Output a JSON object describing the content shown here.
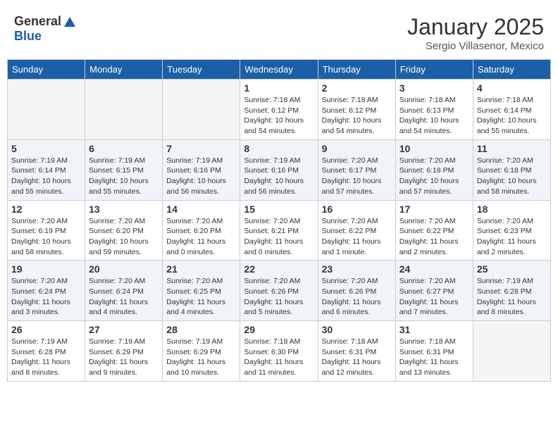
{
  "header": {
    "logo_line1": "General",
    "logo_line2": "Blue",
    "month_title": "January 2025",
    "subtitle": "Sergio Villasenor, Mexico"
  },
  "weekdays": [
    "Sunday",
    "Monday",
    "Tuesday",
    "Wednesday",
    "Thursday",
    "Friday",
    "Saturday"
  ],
  "weeks": [
    [
      {
        "day": "",
        "info": ""
      },
      {
        "day": "",
        "info": ""
      },
      {
        "day": "",
        "info": ""
      },
      {
        "day": "1",
        "info": "Sunrise: 7:18 AM\nSunset: 6:12 PM\nDaylight: 10 hours\nand 54 minutes."
      },
      {
        "day": "2",
        "info": "Sunrise: 7:18 AM\nSunset: 6:12 PM\nDaylight: 10 hours\nand 54 minutes."
      },
      {
        "day": "3",
        "info": "Sunrise: 7:18 AM\nSunset: 6:13 PM\nDaylight: 10 hours\nand 54 minutes."
      },
      {
        "day": "4",
        "info": "Sunrise: 7:18 AM\nSunset: 6:14 PM\nDaylight: 10 hours\nand 55 minutes."
      }
    ],
    [
      {
        "day": "5",
        "info": "Sunrise: 7:19 AM\nSunset: 6:14 PM\nDaylight: 10 hours\nand 55 minutes."
      },
      {
        "day": "6",
        "info": "Sunrise: 7:19 AM\nSunset: 6:15 PM\nDaylight: 10 hours\nand 55 minutes."
      },
      {
        "day": "7",
        "info": "Sunrise: 7:19 AM\nSunset: 6:16 PM\nDaylight: 10 hours\nand 56 minutes."
      },
      {
        "day": "8",
        "info": "Sunrise: 7:19 AM\nSunset: 6:16 PM\nDaylight: 10 hours\nand 56 minutes."
      },
      {
        "day": "9",
        "info": "Sunrise: 7:20 AM\nSunset: 6:17 PM\nDaylight: 10 hours\nand 57 minutes."
      },
      {
        "day": "10",
        "info": "Sunrise: 7:20 AM\nSunset: 6:18 PM\nDaylight: 10 hours\nand 57 minutes."
      },
      {
        "day": "11",
        "info": "Sunrise: 7:20 AM\nSunset: 6:18 PM\nDaylight: 10 hours\nand 58 minutes."
      }
    ],
    [
      {
        "day": "12",
        "info": "Sunrise: 7:20 AM\nSunset: 6:19 PM\nDaylight: 10 hours\nand 58 minutes."
      },
      {
        "day": "13",
        "info": "Sunrise: 7:20 AM\nSunset: 6:20 PM\nDaylight: 10 hours\nand 59 minutes."
      },
      {
        "day": "14",
        "info": "Sunrise: 7:20 AM\nSunset: 6:20 PM\nDaylight: 11 hours\nand 0 minutes."
      },
      {
        "day": "15",
        "info": "Sunrise: 7:20 AM\nSunset: 6:21 PM\nDaylight: 11 hours\nand 0 minutes."
      },
      {
        "day": "16",
        "info": "Sunrise: 7:20 AM\nSunset: 6:22 PM\nDaylight: 11 hours\nand 1 minute."
      },
      {
        "day": "17",
        "info": "Sunrise: 7:20 AM\nSunset: 6:22 PM\nDaylight: 11 hours\nand 2 minutes."
      },
      {
        "day": "18",
        "info": "Sunrise: 7:20 AM\nSunset: 6:23 PM\nDaylight: 11 hours\nand 2 minutes."
      }
    ],
    [
      {
        "day": "19",
        "info": "Sunrise: 7:20 AM\nSunset: 6:24 PM\nDaylight: 11 hours\nand 3 minutes."
      },
      {
        "day": "20",
        "info": "Sunrise: 7:20 AM\nSunset: 6:24 PM\nDaylight: 11 hours\nand 4 minutes."
      },
      {
        "day": "21",
        "info": "Sunrise: 7:20 AM\nSunset: 6:25 PM\nDaylight: 11 hours\nand 4 minutes."
      },
      {
        "day": "22",
        "info": "Sunrise: 7:20 AM\nSunset: 6:26 PM\nDaylight: 11 hours\nand 5 minutes."
      },
      {
        "day": "23",
        "info": "Sunrise: 7:20 AM\nSunset: 6:26 PM\nDaylight: 11 hours\nand 6 minutes."
      },
      {
        "day": "24",
        "info": "Sunrise: 7:20 AM\nSunset: 6:27 PM\nDaylight: 11 hours\nand 7 minutes."
      },
      {
        "day": "25",
        "info": "Sunrise: 7:19 AM\nSunset: 6:28 PM\nDaylight: 11 hours\nand 8 minutes."
      }
    ],
    [
      {
        "day": "26",
        "info": "Sunrise: 7:19 AM\nSunset: 6:28 PM\nDaylight: 11 hours\nand 8 minutes."
      },
      {
        "day": "27",
        "info": "Sunrise: 7:19 AM\nSunset: 6:29 PM\nDaylight: 11 hours\nand 9 minutes."
      },
      {
        "day": "28",
        "info": "Sunrise: 7:19 AM\nSunset: 6:29 PM\nDaylight: 11 hours\nand 10 minutes."
      },
      {
        "day": "29",
        "info": "Sunrise: 7:18 AM\nSunset: 6:30 PM\nDaylight: 11 hours\nand 11 minutes."
      },
      {
        "day": "30",
        "info": "Sunrise: 7:18 AM\nSunset: 6:31 PM\nDaylight: 11 hours\nand 12 minutes."
      },
      {
        "day": "31",
        "info": "Sunrise: 7:18 AM\nSunset: 6:31 PM\nDaylight: 11 hours\nand 13 minutes."
      },
      {
        "day": "",
        "info": ""
      }
    ]
  ]
}
